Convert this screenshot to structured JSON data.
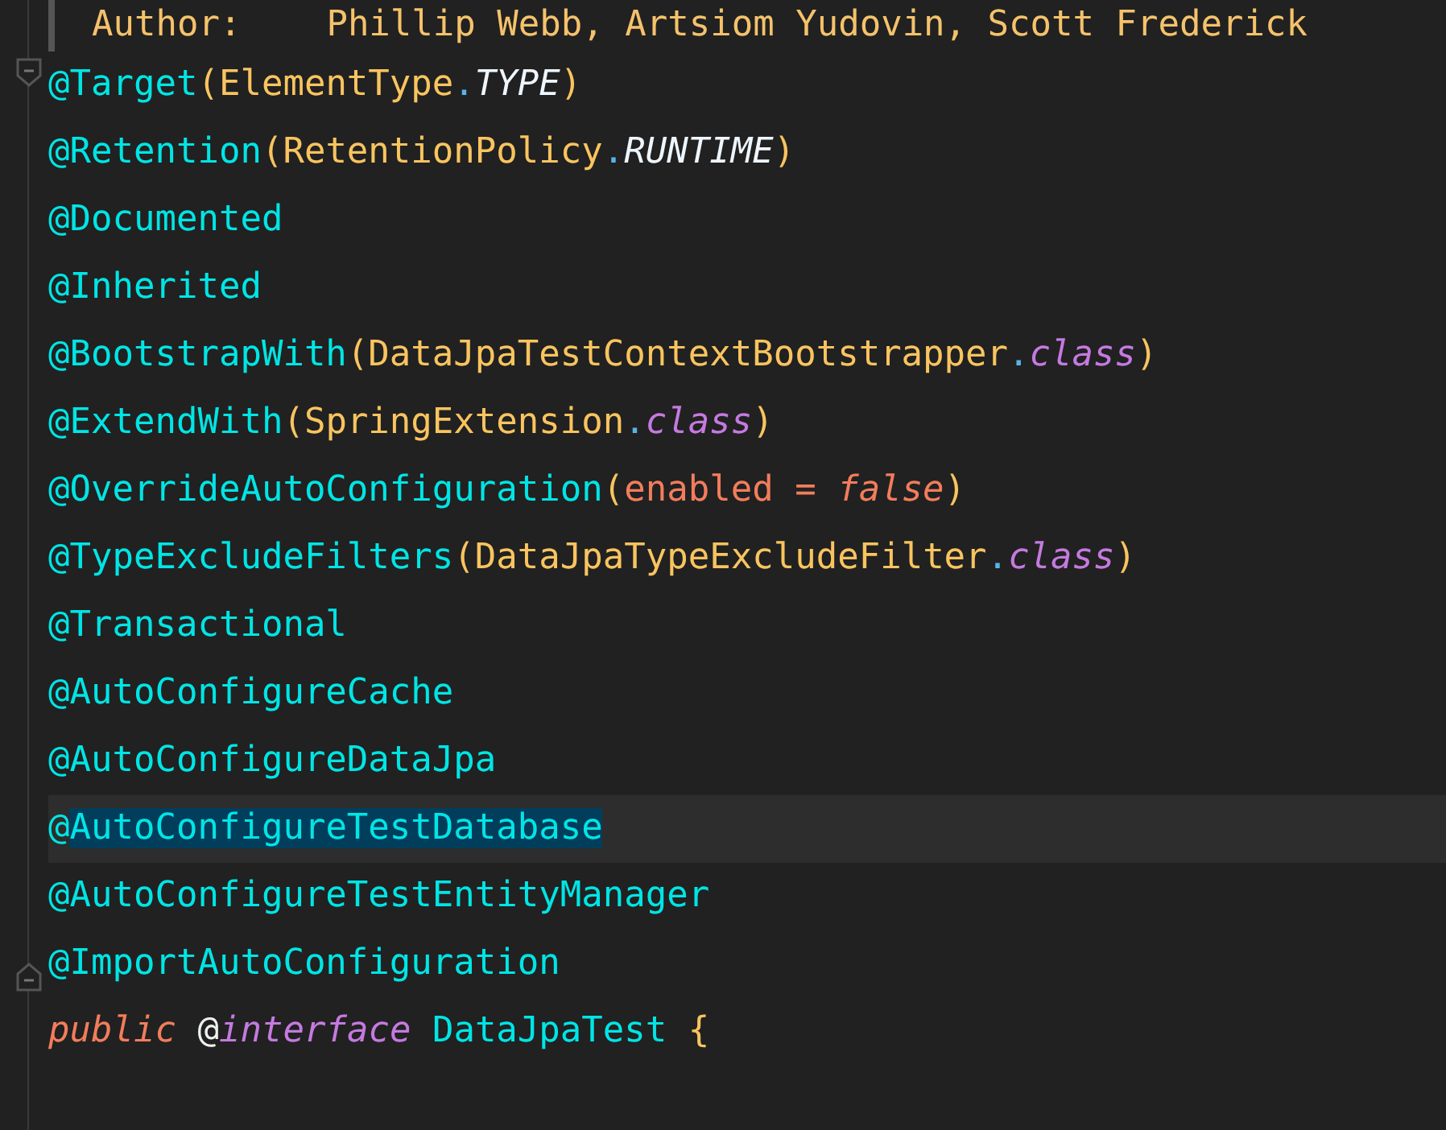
{
  "comment_line": "Author:    Phillip Webb, Artsiom Yudovin, Scott Frederick",
  "lines": [
    {
      "current": false,
      "fold_open": true,
      "tokens": [
        {
          "kind": "annotation",
          "text": "@Target"
        },
        {
          "kind": "type",
          "text": "(ElementType"
        },
        {
          "kind": "member_constant",
          "text": ".TYPE"
        },
        {
          "kind": "type",
          "text": ")"
        }
      ]
    },
    {
      "current": false,
      "tokens": [
        {
          "kind": "annotation",
          "text": "@Retention"
        },
        {
          "kind": "type",
          "text": "(RetentionPolicy"
        },
        {
          "kind": "member_constant",
          "text": ".RUNTIME"
        },
        {
          "kind": "type",
          "text": ")"
        }
      ]
    },
    {
      "current": false,
      "tokens": [
        {
          "kind": "annotation",
          "text": "@Documented"
        }
      ]
    },
    {
      "current": false,
      "tokens": [
        {
          "kind": "annotation",
          "text": "@Inherited"
        }
      ]
    },
    {
      "current": false,
      "tokens": [
        {
          "kind": "annotation",
          "text": "@BootstrapWith"
        },
        {
          "kind": "type",
          "text": "(DataJpaTestContextBootstrapper"
        },
        {
          "kind": "member_keyword",
          "text": ".class"
        },
        {
          "kind": "type",
          "text": ")"
        }
      ]
    },
    {
      "current": false,
      "tokens": [
        {
          "kind": "annotation",
          "text": "@ExtendWith"
        },
        {
          "kind": "type",
          "text": "(SpringExtension"
        },
        {
          "kind": "member_keyword",
          "text": ".class"
        },
        {
          "kind": "type",
          "text": ")"
        }
      ]
    },
    {
      "current": false,
      "tokens": [
        {
          "kind": "annotation",
          "text": "@OverrideAutoConfiguration"
        },
        {
          "kind": "type",
          "text": "("
        },
        {
          "kind": "param",
          "text": "enabled = "
        },
        {
          "kind": "literal",
          "text": "false"
        },
        {
          "kind": "type",
          "text": ")"
        }
      ]
    },
    {
      "current": false,
      "tokens": [
        {
          "kind": "annotation",
          "text": "@TypeExcludeFilters"
        },
        {
          "kind": "type",
          "text": "(DataJpaTypeExcludeFilter"
        },
        {
          "kind": "member_keyword",
          "text": ".class"
        },
        {
          "kind": "type",
          "text": ")"
        }
      ]
    },
    {
      "current": false,
      "tokens": [
        {
          "kind": "annotation",
          "text": "@Transactional"
        }
      ]
    },
    {
      "current": false,
      "tokens": [
        {
          "kind": "annotation",
          "text": "@AutoConfigureCache"
        }
      ]
    },
    {
      "current": false,
      "tokens": [
        {
          "kind": "annotation",
          "text": "@AutoConfigureDataJpa"
        }
      ]
    },
    {
      "current": true,
      "tokens": [
        {
          "kind": "annotation",
          "text": "@"
        },
        {
          "kind": "selection",
          "text": "AutoConfigureTestDatabase"
        }
      ]
    },
    {
      "current": false,
      "tokens": [
        {
          "kind": "annotation",
          "text": "@AutoConfigureTestEntityManager"
        }
      ]
    },
    {
      "current": false,
      "fold_close": true,
      "tokens": [
        {
          "kind": "annotation",
          "text": "@ImportAutoConfiguration"
        }
      ]
    },
    {
      "current": false,
      "tokens": [
        {
          "kind": "modifier",
          "text": "public"
        },
        {
          "kind": "plain",
          "text": " @"
        },
        {
          "kind": "keyword",
          "text": "interface"
        },
        {
          "kind": "annotation",
          "text": " DataJpaTest "
        },
        {
          "kind": "type",
          "text": "{"
        }
      ]
    }
  ]
}
